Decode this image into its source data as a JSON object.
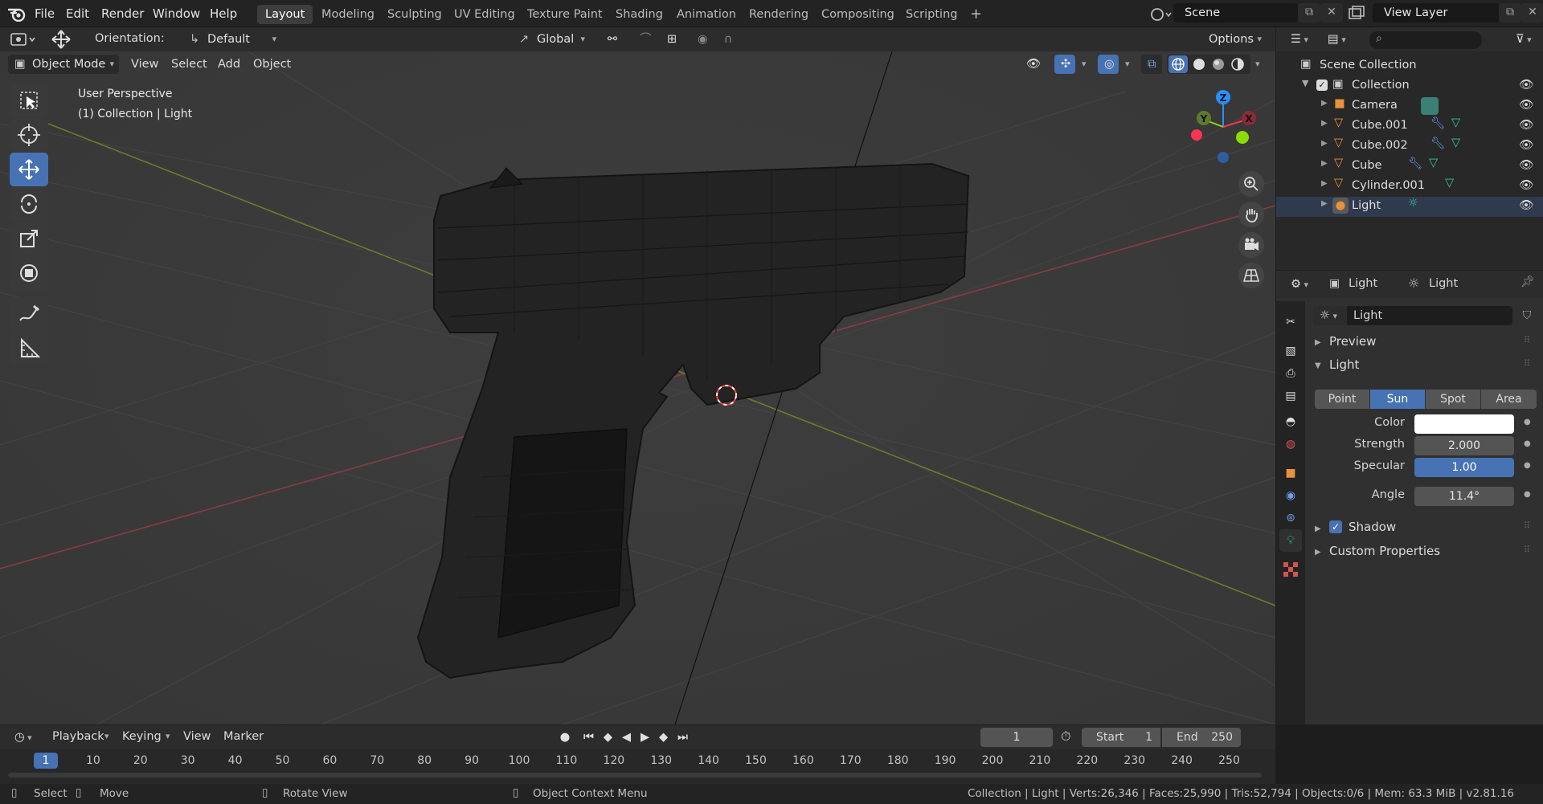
{
  "menubar": {
    "items": [
      "File",
      "Edit",
      "Render",
      "Window",
      "Help"
    ],
    "workspaces": [
      "Layout",
      "Modeling",
      "Sculpting",
      "UV Editing",
      "Texture Paint",
      "Shading",
      "Animation",
      "Rendering",
      "Compositing",
      "Scripting"
    ],
    "active_workspace": "Layout",
    "add_tab": "+",
    "scene_name": "Scene",
    "view_layer": "View Layer"
  },
  "viewport_header": {
    "orientation_label": "Orientation:",
    "orientation_value": "Default",
    "transform_space": "Global",
    "options": "Options",
    "mode": "Object Mode",
    "menus": [
      "View",
      "Select",
      "Add",
      "Object"
    ]
  },
  "viewport": {
    "view_name": "User Perspective",
    "context": "(1) Collection | Light",
    "gizmo": {
      "z": "Z",
      "y": "Y",
      "x": "X"
    }
  },
  "outliner": {
    "root": "Scene Collection",
    "collection": "Collection",
    "objects": [
      {
        "name": "Camera",
        "icon": "camera-icon"
      },
      {
        "name": "Cube.001",
        "icon": "mesh-icon"
      },
      {
        "name": "Cube.002",
        "icon": "mesh-icon"
      },
      {
        "name": "Cube",
        "icon": "mesh-icon"
      },
      {
        "name": "Cylinder.001",
        "icon": "mesh-icon"
      },
      {
        "name": "Light",
        "icon": "light-icon"
      }
    ]
  },
  "properties": {
    "breadcrumb_object": "Light",
    "breadcrumb_data": "Light",
    "datablock_name": "Light",
    "panels": {
      "preview": "Preview",
      "light": "Light",
      "shadow": "Shadow",
      "custom": "Custom Properties"
    },
    "light_types": [
      "Point",
      "Sun",
      "Spot",
      "Area"
    ],
    "active_type": "Sun",
    "fields": {
      "color_label": "Color",
      "color_value": "#ffffff",
      "strength_label": "Strength",
      "strength_value": "2.000",
      "specular_label": "Specular",
      "specular_value": "1.00",
      "angle_label": "Angle",
      "angle_value": "11.4°"
    },
    "shadow_enabled": true
  },
  "timeline": {
    "menus": [
      "Playback",
      "Keying",
      "View",
      "Marker"
    ],
    "current_frame": "1",
    "start_label": "Start",
    "start_value": "1",
    "end_label": "End",
    "end_value": "250",
    "ruler": [
      "1",
      "10",
      "20",
      "30",
      "40",
      "50",
      "60",
      "70",
      "80",
      "90",
      "100",
      "110",
      "120",
      "130",
      "140",
      "150",
      "160",
      "170",
      "180",
      "190",
      "200",
      "210",
      "220",
      "230",
      "240",
      "250"
    ]
  },
  "statusbar": {
    "select": "Select",
    "move": "Move",
    "rotate": "Rotate View",
    "context_menu": "Object Context Menu",
    "stats": "Collection | Light | Verts:26,346 | Faces:25,990 | Tris:52,794 | Objects:0/6 | Mem: 63.3 MiB | v2.81.16"
  },
  "colors": {
    "accent": "#4772b3",
    "x_axis": "#ff3352",
    "y_axis": "#8bdc00",
    "z_axis": "#2890ff",
    "header_bg": "#232323",
    "viewport_bg": "#3a3a3a"
  }
}
